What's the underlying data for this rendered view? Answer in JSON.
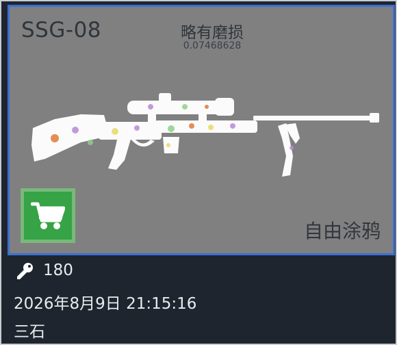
{
  "item": {
    "weapon_name": "SSG-08",
    "wear_label": "略有磨损",
    "float_value": "0.07468628",
    "skin_name": "自由涂鸦",
    "image_icon": "rifle-image",
    "buy_icon": "shopping-cart-icon"
  },
  "listing": {
    "price_icon": "key-icon",
    "price": "180",
    "datetime": "2026年8月9日 21:15:16",
    "seller": "三石"
  },
  "colors": {
    "panel_background": "#808080",
    "panel_border": "#3b6fd6",
    "buy_button": "#35a346",
    "card_background": "#1f252e"
  }
}
